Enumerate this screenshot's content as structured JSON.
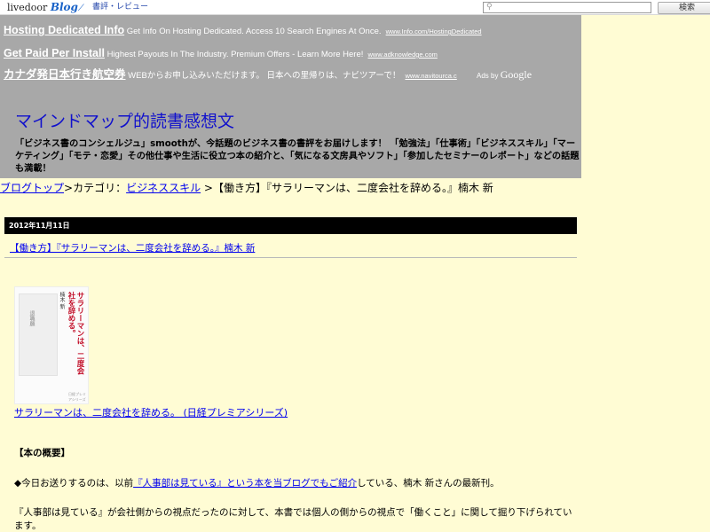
{
  "topbar": {
    "logo_text": "livedoor",
    "logo_blog": "Blog",
    "genre_link": "書評・レビュー",
    "search_placeholder": "",
    "search_button": "検索"
  },
  "ads": [
    {
      "head": "Hosting Dedicated Info",
      "desc": " Get Info On Hosting Dedicated. Access 10 Search Engines At Once.",
      "url": "www.Info.com/HostingDedicated"
    },
    {
      "head": "Get Paid Per Install",
      "desc": " Highest Payouts In The Industry. Premium Offers - Learn More Here!",
      "url": "www.adknowledge.com"
    },
    {
      "head": "カナダ発日本行き航空券",
      "desc": " WEBからお申し込みいただけます。 日本への里帰りは、ナビツアーで！",
      "url": "www.navitourca.c"
    }
  ],
  "ads_by": {
    "prefix": "Ads by ",
    "brand": "Google"
  },
  "header": {
    "title": "マインドマップ的読書感想文",
    "description": "「ビジネス書のコンシェルジュ」smoothが、今話題のビジネス書の書評をお届けします！ 「勉強法」「仕事術」「ビジネススキル」「マーケティング」「モテ・恋愛」その他仕事や生活に役立つ本の紹介と、「気になる文房具やソフト」「参加したセミナーのレポート」などの話題も満載！"
  },
  "breadcrumb": {
    "top_link": "ブログトップ",
    "sep1": ">カテゴリ：",
    "category_link": "ビジネススキル",
    "sep2": " >【働き方】『サラリーマンは、二度会社を辞める。』楠木 新"
  },
  "post": {
    "date": "2012年11月11日",
    "title": "【働き方】『サラリーマンは、二度会社を辞める。』楠木 新",
    "cover": {
      "band_text": "退職願",
      "author": "楠木 新",
      "vertical_title": "サラリーマンは、二度会社を辞める。",
      "publisher": "日経プレミアシリーズ"
    },
    "book_link": "サラリーマンは、二度会社を辞める。 (日経プレミアシリーズ)",
    "summary_heading": "【本の概要】",
    "p1_before": "◆今日お送りするのは、以前",
    "p1_link": "『人事部は見ている』という本を当ブログでもご紹介",
    "p1_after": "している、楠木 新さんの最新刊。",
    "p2": "『人事部は見ている』が会社側からの視点だったのに対して、本書では個人の側からの視点で「働くこと」に関して掘り下げられています。"
  }
}
